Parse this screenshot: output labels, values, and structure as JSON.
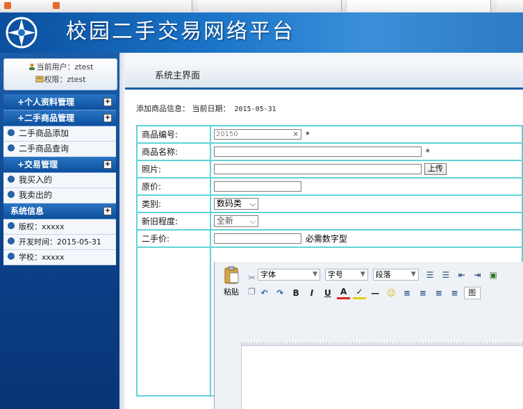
{
  "browser": {
    "tabs": [
      "",
      "",
      "",
      "",
      ""
    ]
  },
  "banner": {
    "title": "校园二手交易网络平台"
  },
  "user": {
    "current_user_label": "当前用户：ztest",
    "permission_label": "权限：ztest"
  },
  "sidebar": {
    "groups": [
      {
        "title": "+个人资料管理",
        "items": []
      },
      {
        "title": "+二手商品管理",
        "items": [
          "二手商品添加",
          "二手商品查询"
        ]
      },
      {
        "title": "+交易管理",
        "items": [
          "我买入的",
          "我卖出的"
        ]
      },
      {
        "title": "系统信息",
        "items": [
          "版权：xxxxx",
          "开发时间：2015-05-31",
          "学校：xxxxx"
        ]
      }
    ],
    "expand_symbol": "+"
  },
  "content": {
    "page_title": "系统主界面",
    "info_label": "添加商品信息：",
    "date_label": "当前日期：",
    "date_value": "2015-05-31"
  },
  "form": {
    "code_label": "商品编号:",
    "code_value": "20150",
    "clear_symbol": "×",
    "required_mark": "*",
    "name_label": "商品名称:",
    "photo_label": "照片:",
    "upload_button": "上传",
    "original_price_label": "原价:",
    "category_label": "类别:",
    "category_value": "数码类",
    "condition_label": "新旧程度:",
    "condition_value": "全新",
    "secondhand_price_label": "二手价:",
    "secondhand_hint": "必需数字型"
  },
  "editor": {
    "paste_label": "粘贴",
    "font_combo": "字体",
    "size_combo": "字号",
    "paragraph_combo": "段落",
    "image_label": "图",
    "colors": {
      "accent": "#1a5ca6",
      "border": "#5fd3d8"
    }
  }
}
